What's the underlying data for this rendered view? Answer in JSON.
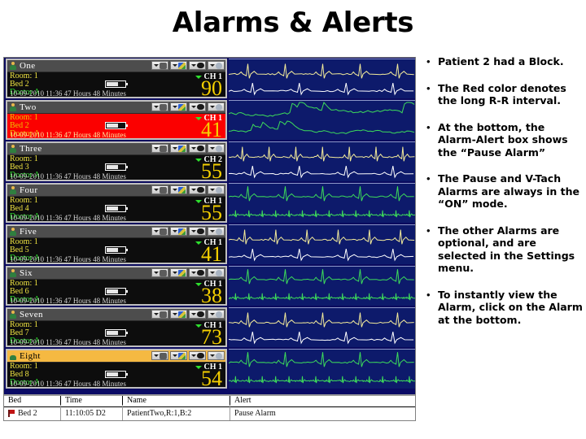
{
  "slide": {
    "title": "Alarms & Alerts"
  },
  "monitor": {
    "patients": [
      {
        "name": "One",
        "room": "Room: 1",
        "bed": "Bed 2",
        "doctor": "Doctor A",
        "timestamp": "10-09-2010  11:36  47 Hours 48 Minutes",
        "channel": "CH 1",
        "hr": "90",
        "alarm": false,
        "highlight": false
      },
      {
        "name": "Two",
        "room": "Room: 1",
        "bed": "Bed 2",
        "doctor": "Doctor A",
        "timestamp": "10-09-2010  11:36  47 Hours 48 Minutes",
        "channel": "CH 1",
        "hr": "41",
        "alarm": true,
        "highlight": false
      },
      {
        "name": "Three",
        "room": "Room: 1",
        "bed": "Bed 3",
        "doctor": "Doctor A",
        "timestamp": "10-09-2010  11:36  47 Hours 48 Minutes",
        "channel": "CH 2",
        "hr": "55",
        "alarm": false,
        "highlight": false
      },
      {
        "name": "Four",
        "room": "Room: 1",
        "bed": "Bed 4",
        "doctor": "Doctor A",
        "timestamp": "10-09-2010  11:36  47 Hours 48 Minutes",
        "channel": "CH 1",
        "hr": "55",
        "alarm": false,
        "highlight": false
      },
      {
        "name": "Five",
        "room": "Room: 1",
        "bed": "Bed 5",
        "doctor": "Doctor A",
        "timestamp": "10-09-2010  11:36  47 Hours 48 Minutes",
        "channel": "CH 1",
        "hr": "41",
        "alarm": false,
        "highlight": false
      },
      {
        "name": "Six",
        "room": "Room: 1",
        "bed": "Bed 6",
        "doctor": "Doctor A",
        "timestamp": "10-09-2010  11:36  47 Hours 48 Minutes",
        "channel": "CH 1",
        "hr": "38",
        "alarm": false,
        "highlight": false
      },
      {
        "name": "Seven",
        "room": "Room: 1",
        "bed": "Bed 7",
        "doctor": "Doctor A",
        "timestamp": "10-09-2010  11:36  47 Hours 48 Minutes",
        "channel": "CH 1",
        "hr": "73",
        "alarm": false,
        "highlight": false
      },
      {
        "name": "Eight",
        "room": "Room: 1",
        "bed": "Bed 8",
        "doctor": "Doctor A",
        "timestamp": "10-09-2010  11:36  47 Hours 48 Minutes",
        "channel": "CH 1",
        "hr": "54",
        "alarm": false,
        "highlight": true
      }
    ],
    "card_buttons": [
      "dropdown-settings-button",
      "color-palette-button",
      "view-eye-button",
      "options-button"
    ],
    "colors": {
      "waveform_background": "#0d1a6b",
      "waveform_yellow": "#f2ea9a",
      "waveform_green": "#3ddc5a",
      "alarm_red": "#fb0000",
      "highlight_amber": "#f5b942",
      "hr_yellow": "#f5d000",
      "room_yellow": "#f0e442",
      "doctor_green": "#2ee02e"
    }
  },
  "alert_table": {
    "columns": [
      "Bed",
      "Time",
      "Name",
      "Alert"
    ],
    "rows": [
      {
        "bed": "Bed 2",
        "time": "11:10:05 D2",
        "name": "PatientTwo,R:1,B:2",
        "alert": "Pause Alarm"
      }
    ]
  },
  "bullets": [
    "Patient 2 had a Block.",
    "The Red color denotes the long R-R interval.",
    "At the bottom, the Alarm-Alert  box shows the “Pause Alarm”",
    "The Pause and V-Tach Alarms are always in the “ON” mode.",
    "The other Alarms are optional, and are selected in the Settings menu.",
    "To instantly view the Alarm, click on the Alarm at the bottom."
  ],
  "bullet_marker": "•"
}
